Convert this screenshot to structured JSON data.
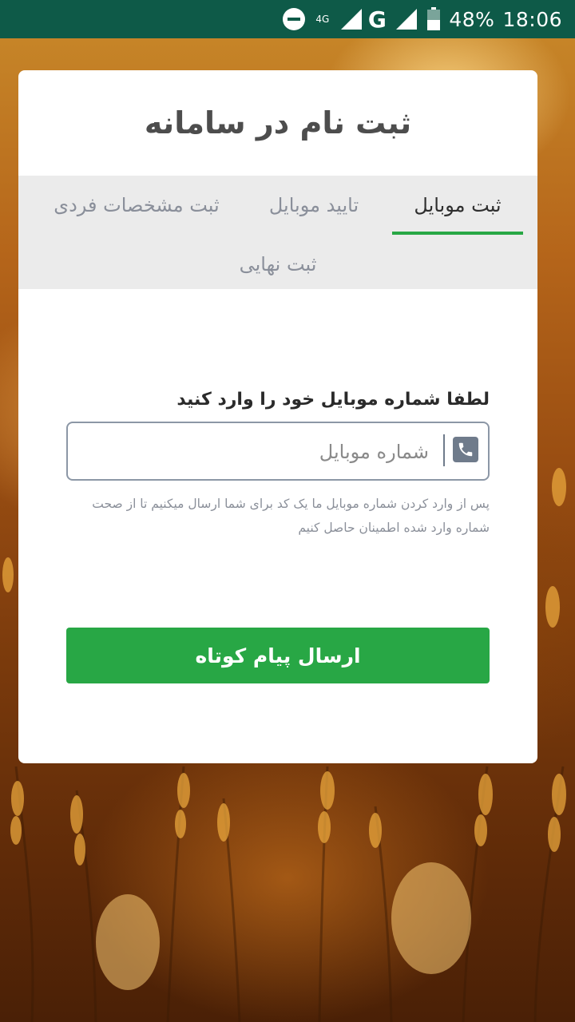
{
  "status_bar": {
    "network_type": "4G",
    "network_letter": "G",
    "battery_percent": "48%",
    "time": "18:06",
    "icons": [
      "do-not-disturb-icon",
      "data-arrows-icon",
      "signal-icon",
      "signal-icon",
      "battery-icon"
    ]
  },
  "form": {
    "title": "ثبت نام در سامانه",
    "tabs": [
      {
        "label": "ثبت موبایل",
        "active": true
      },
      {
        "label": "تایید موبایل",
        "active": false
      },
      {
        "label": "ثبت مشخصات فردی",
        "active": false
      },
      {
        "label": "ثبت نهایی",
        "active": false
      }
    ],
    "mobile_label": "لطفا شماره موبایل خود را وارد کنید",
    "mobile_input": {
      "placeholder": "شماره موبایل",
      "value": "",
      "icon": "phone-icon"
    },
    "help_text": "پس از وارد کردن شماره موبایل ما یک کد برای شما ارسال میکنیم تا از صحت شماره وارد شده اطمینان حاصل کنیم",
    "submit_label": "ارسال پیام کوتاه"
  },
  "colors": {
    "status_bar": "#0e5a48",
    "accent": "#28a745",
    "tab_bar": "#ebebeb"
  }
}
